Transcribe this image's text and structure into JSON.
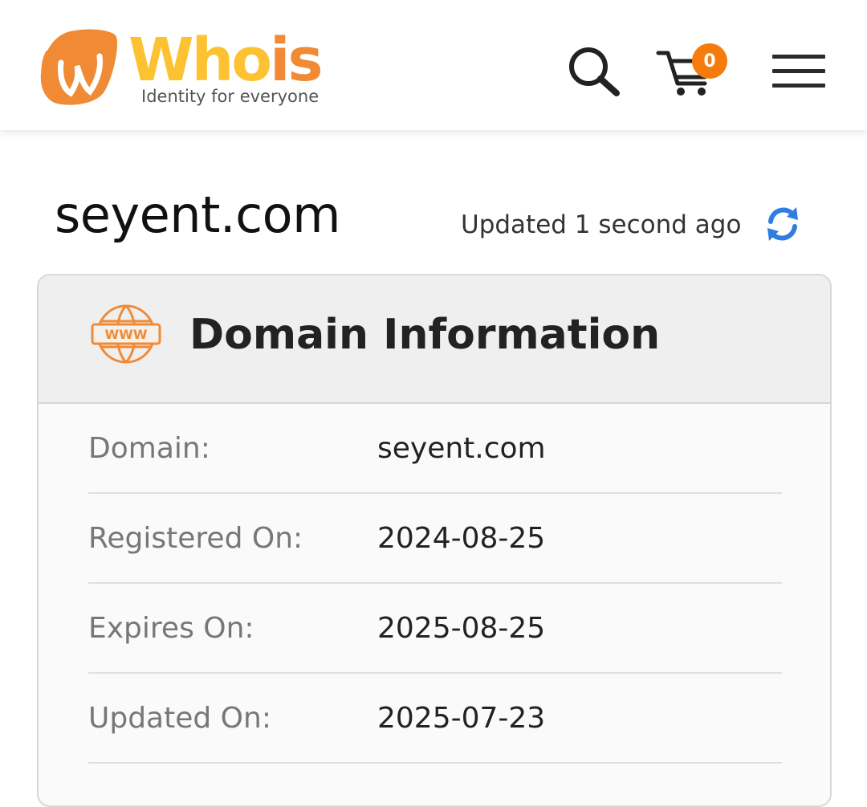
{
  "header": {
    "logo": {
      "word_main": "Who",
      "word_tail": "is",
      "tagline": "Identity for everyone"
    },
    "cart_count": "0",
    "icons": {
      "search": "search-icon",
      "cart": "cart-icon",
      "menu": "hamburger-menu-icon"
    },
    "colors": {
      "logo_yellow": "#fdc232",
      "logo_orange": "#f18a34",
      "badge": "#f47b0c"
    }
  },
  "page": {
    "domain": "seyent.com",
    "updated_text": "Updated 1 second ago",
    "refresh_icon": "refresh-icon",
    "refresh_color": "#2f7de1"
  },
  "domain_info": {
    "title": "Domain Information",
    "icon": "www-globe-icon",
    "rows": [
      {
        "label": "Domain:",
        "value": "seyent.com"
      },
      {
        "label": "Registered On:",
        "value": "2024-08-25"
      },
      {
        "label": "Expires On:",
        "value": "2025-08-25"
      },
      {
        "label": "Updated On:",
        "value": "2025-07-23"
      }
    ]
  }
}
